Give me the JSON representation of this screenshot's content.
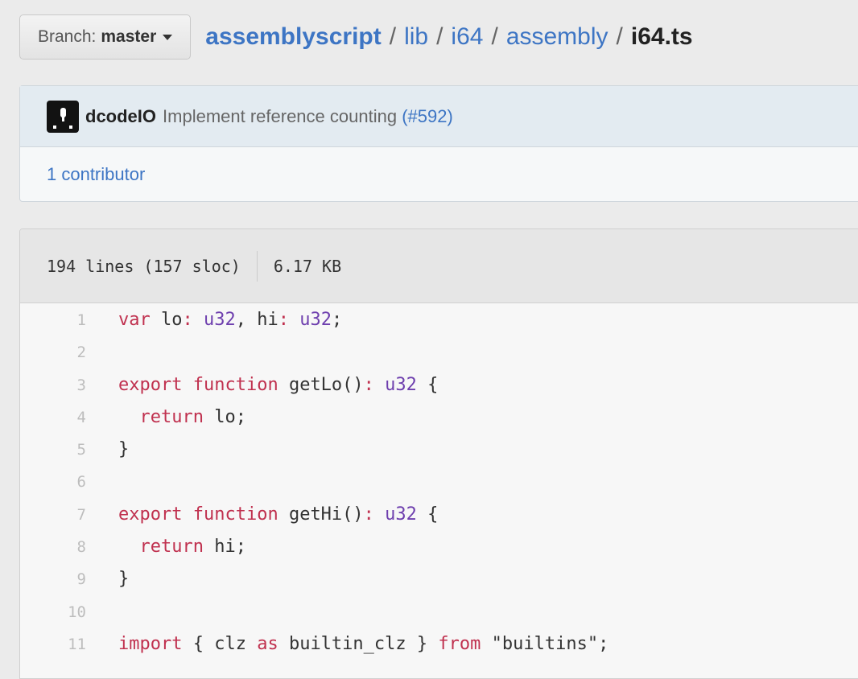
{
  "branch": {
    "label": "Branch:",
    "value": "master"
  },
  "breadcrumb": {
    "repo": "assemblyscript",
    "path": [
      "lib",
      "i64",
      "assembly"
    ],
    "file": "i64.ts"
  },
  "commit": {
    "author": "dcodeIO",
    "message": "Implement reference counting",
    "pr": "(#592)"
  },
  "contributors": "1 contributor",
  "file_info": {
    "lines": "194 lines (157 sloc)",
    "size": "6.17 KB"
  },
  "code_lines": [
    {
      "num": "1",
      "tokens": [
        {
          "t": "var",
          "c": "kw"
        },
        {
          "t": " lo",
          "c": ""
        },
        {
          "t": ":",
          "c": "kw"
        },
        {
          "t": " ",
          "c": ""
        },
        {
          "t": "u32",
          "c": "ty"
        },
        {
          "t": ", hi",
          "c": ""
        },
        {
          "t": ":",
          "c": "kw"
        },
        {
          "t": " ",
          "c": ""
        },
        {
          "t": "u32",
          "c": "ty"
        },
        {
          "t": ";",
          "c": ""
        }
      ]
    },
    {
      "num": "2",
      "tokens": []
    },
    {
      "num": "3",
      "tokens": [
        {
          "t": "export",
          "c": "kw"
        },
        {
          "t": " ",
          "c": ""
        },
        {
          "t": "function",
          "c": "kw"
        },
        {
          "t": " getLo()",
          "c": ""
        },
        {
          "t": ":",
          "c": "kw"
        },
        {
          "t": " ",
          "c": ""
        },
        {
          "t": "u32",
          "c": "ty"
        },
        {
          "t": " {",
          "c": ""
        }
      ]
    },
    {
      "num": "4",
      "tokens": [
        {
          "t": "  ",
          "c": ""
        },
        {
          "t": "return",
          "c": "kw"
        },
        {
          "t": " lo;",
          "c": ""
        }
      ]
    },
    {
      "num": "5",
      "tokens": [
        {
          "t": "}",
          "c": ""
        }
      ]
    },
    {
      "num": "6",
      "tokens": []
    },
    {
      "num": "7",
      "tokens": [
        {
          "t": "export",
          "c": "kw"
        },
        {
          "t": " ",
          "c": ""
        },
        {
          "t": "function",
          "c": "kw"
        },
        {
          "t": " getHi()",
          "c": ""
        },
        {
          "t": ":",
          "c": "kw"
        },
        {
          "t": " ",
          "c": ""
        },
        {
          "t": "u32",
          "c": "ty"
        },
        {
          "t": " {",
          "c": ""
        }
      ]
    },
    {
      "num": "8",
      "tokens": [
        {
          "t": "  ",
          "c": ""
        },
        {
          "t": "return",
          "c": "kw"
        },
        {
          "t": " hi;",
          "c": ""
        }
      ]
    },
    {
      "num": "9",
      "tokens": [
        {
          "t": "}",
          "c": ""
        }
      ]
    },
    {
      "num": "10",
      "tokens": []
    },
    {
      "num": "11",
      "tokens": [
        {
          "t": "import",
          "c": "kw"
        },
        {
          "t": " { clz ",
          "c": ""
        },
        {
          "t": "as",
          "c": "kw"
        },
        {
          "t": " builtin_clz } ",
          "c": ""
        },
        {
          "t": "from",
          "c": "kw"
        },
        {
          "t": " ",
          "c": ""
        },
        {
          "t": "\"builtins\"",
          "c": "str"
        },
        {
          "t": ";",
          "c": ""
        }
      ]
    }
  ],
  "colors": {
    "link": "#3d75c4",
    "keyword": "#c0314f",
    "type": "#6e3fae"
  }
}
